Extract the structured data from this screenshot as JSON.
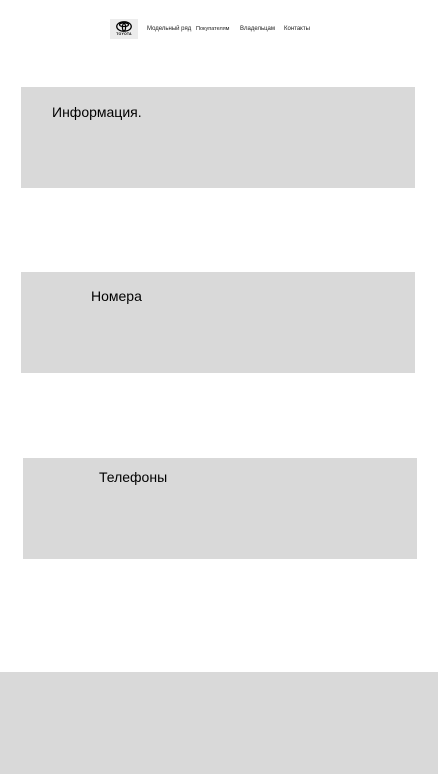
{
  "header": {
    "logo": {
      "icon": "toyota-logo-icon",
      "text": "TOYOTA"
    },
    "nav": [
      {
        "label": "Модельный ряд"
      },
      {
        "label": "Покупателям"
      },
      {
        "label": "Владельцам"
      },
      {
        "label": "Контакты"
      }
    ]
  },
  "sections": [
    {
      "title": "Информация."
    },
    {
      "title": "Номера"
    },
    {
      "title": "Телефоны"
    }
  ],
  "colors": {
    "card_background": "#d9d9d9",
    "page_background": "#ffffff",
    "text": "#000000"
  }
}
